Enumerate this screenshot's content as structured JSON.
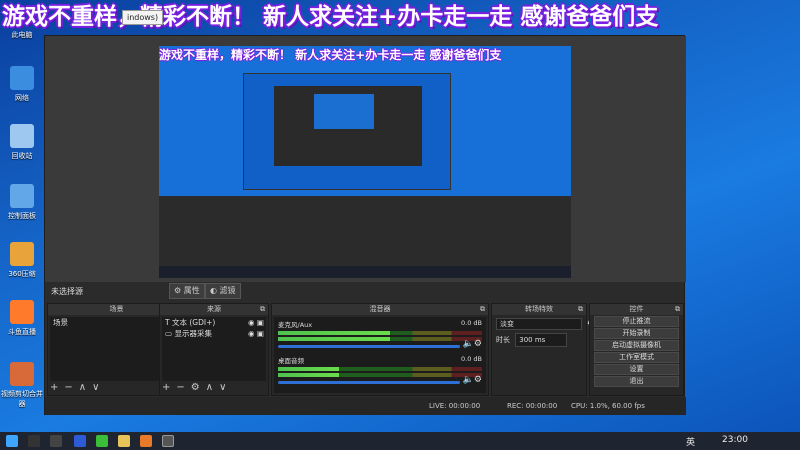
{
  "banner_text": "游戏不重样，精彩不断！ 新人求关注+办卡走一走 感谢爸爸们支",
  "tooltip_text": "indows)",
  "desktop_icons": [
    {
      "label": "此电脑",
      "icon": "computer-icon",
      "color": "#4aa3ff"
    },
    {
      "label": "网络",
      "icon": "network-icon",
      "color": "#3b8de0"
    },
    {
      "label": "回收站",
      "icon": "recycle-bin-icon",
      "color": "#9fc8f0"
    },
    {
      "label": "控制面板",
      "icon": "control-panel-icon",
      "color": "#62a8e8"
    },
    {
      "label": "360压缩",
      "icon": "archive-icon",
      "color": "#e8a33a"
    },
    {
      "label": "斗鱼直播",
      "icon": "douyu-icon",
      "color": "#ff7a2a"
    },
    {
      "label": "视频剪切合并器",
      "icon": "video-tool-icon",
      "color": "#d86a3a"
    }
  ],
  "preview": {
    "banner_text": "游戏不重样，精彩不断！ 新人求关注+办卡走一走 感谢爸爸们支"
  },
  "status": {
    "no_source": "未选择源",
    "properties_btn": "属性",
    "filters_btn": "滤镜"
  },
  "docks": {
    "scenes_title": "场景",
    "sources_title": "来源",
    "mixer_title": "混音器",
    "transitions_title": "转场特效",
    "controls_title": "控件"
  },
  "scenes": [
    "场景"
  ],
  "sources": [
    {
      "label": "文本 (GDI+)",
      "icon": "text-icon"
    },
    {
      "label": "显示器采集",
      "icon": "monitor-icon"
    }
  ],
  "mixer": [
    {
      "name": "麦克风/Aux",
      "db": "0.0 dB",
      "level": 0.55
    },
    {
      "name": "桌面音频",
      "db": "0.0 dB",
      "level": 0.3
    }
  ],
  "transitions": {
    "selected": "淡变",
    "duration_label": "时长",
    "duration_value": "300 ms"
  },
  "controls": [
    "停止推流",
    "开始录制",
    "启动虚拟摄像机",
    "工作室模式",
    "设置",
    "退出"
  ],
  "statusbar": {
    "live": "LIVE: 00:00:00",
    "rec": "REC: 00:00:00",
    "cpu": "CPU: 1.0%, 60.00 fps"
  },
  "taskbar": {
    "lang": "英",
    "time": "23:00"
  }
}
